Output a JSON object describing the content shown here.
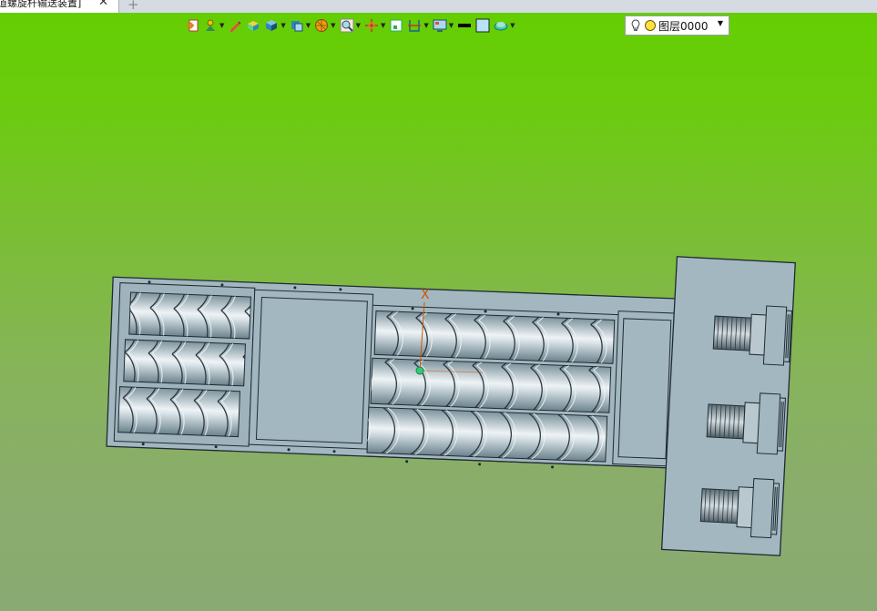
{
  "tab": {
    "title": "道螺旋杆输送装置]",
    "close_glyph": "✕",
    "new_tab_glyph": "+"
  },
  "toolbar": {
    "items": [
      {
        "icon": "exit-sketch-icon",
        "dropdown": false
      },
      {
        "icon": "snap-icon",
        "dropdown": true
      },
      {
        "icon": "pen-icon",
        "dropdown": false
      },
      {
        "icon": "shaded-box-icon",
        "dropdown": false
      },
      {
        "icon": "box-view-icon",
        "dropdown": true
      },
      {
        "icon": "view-orientation-icon",
        "dropdown": true
      },
      {
        "icon": "render-sphere-icon",
        "dropdown": true
      },
      {
        "icon": "zoom-icon",
        "dropdown": true
      },
      {
        "icon": "pan-icon",
        "dropdown": true
      },
      {
        "icon": "fit-view-icon",
        "dropdown": false
      },
      {
        "icon": "section-icon",
        "dropdown": true
      },
      {
        "icon": "display-settings-icon",
        "dropdown": true
      },
      {
        "icon": "line-color-icon",
        "dropdown": false
      },
      {
        "icon": "fill-color-icon",
        "dropdown": false
      },
      {
        "icon": "layer-style-icon",
        "dropdown": true
      }
    ],
    "layer": {
      "name": "图层0000",
      "arrow": "▼"
    }
  },
  "viewport": {
    "axis_label": "X",
    "colors": {
      "body": "#a3b7c0",
      "line": "#1f2a33",
      "screw_light": "#e9eff2",
      "screw_dark": "#6f8792"
    }
  }
}
